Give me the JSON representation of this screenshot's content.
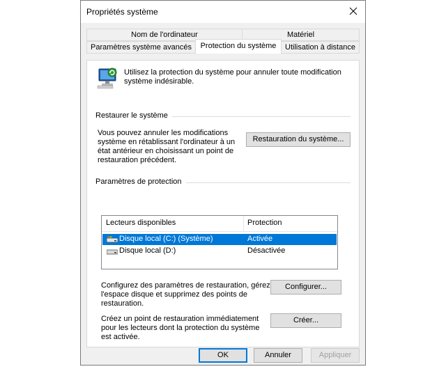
{
  "window": {
    "title": "Propriétés système"
  },
  "tabs": {
    "row1": [
      {
        "label": "Nom de l'ordinateur"
      },
      {
        "label": "Matériel"
      }
    ],
    "row2": [
      {
        "label": "Paramètres système avancés"
      },
      {
        "label": "Protection du système",
        "active": true
      },
      {
        "label": "Utilisation à distance"
      }
    ]
  },
  "intro": {
    "text_line1": "Utilisez la protection du système pour annuler toute modification",
    "text_line2": "système indésirable."
  },
  "restore": {
    "group_label": "Restaurer le système",
    "desc_line1": "Vous pouvez annuler les modifications",
    "desc_line2": "système en rétablissant l'ordinateur à un",
    "desc_line3": "état antérieur en choisissant un point de",
    "desc_line4": "restauration précédent.",
    "button_label": "Restauration du système..."
  },
  "protection": {
    "group_label": "Paramètres de protection",
    "columns": {
      "drive": "Lecteurs disponibles",
      "protection": "Protection"
    },
    "drives": [
      {
        "name": "Disque local (C:) (Système)",
        "status": "Activée",
        "selected": true,
        "icon": "system-drive-icon"
      },
      {
        "name": "Disque local (D:)",
        "status": "Désactivée",
        "selected": false,
        "icon": "drive-icon"
      }
    ],
    "configure_desc_line1": "Configurez des paramètres de restauration, gérez",
    "configure_desc_line2": "l'espace disque et supprimez des points de",
    "configure_desc_line3": "restauration.",
    "configure_button": "Configurer...",
    "create_desc_line1": "Créez un point de restauration immédiatement",
    "create_desc_line2": "pour les lecteurs dont la protection du système",
    "create_desc_line3": "est activée.",
    "create_button": "Créer..."
  },
  "footer": {
    "ok": "OK",
    "cancel": "Annuler",
    "apply": "Appliquer"
  },
  "colors": {
    "selection": "#0078d7",
    "panel_bg": "#f0f0f0"
  }
}
